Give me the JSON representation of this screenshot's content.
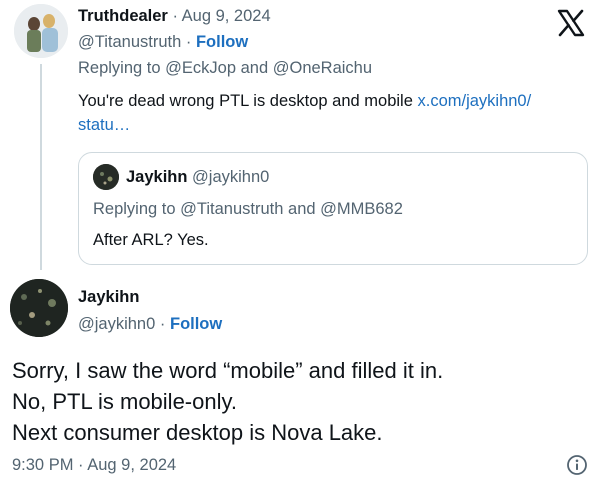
{
  "tweet": {
    "author_name": "Truthdealer",
    "date": "Aug 9, 2024",
    "handle": "@Titanustruth",
    "follow_label": "Follow",
    "replying_prefix": "Replying to",
    "replying_user_1": "@EckJop",
    "replying_and": "and",
    "replying_user_2": "@OneRaichu",
    "text": "You're dead wrong PTL is desktop and mobile",
    "link_line_1": "x.com/jaykihn0/",
    "link_line_2": "statu…"
  },
  "quote": {
    "author_name": "Jaykihn",
    "handle": "@jaykihn0",
    "replying_prefix": "Replying to",
    "replying_user_1": "@Titanustruth",
    "replying_and": "and",
    "replying_user_2": "@MMB682",
    "text": "After ARL? Yes."
  },
  "reply": {
    "author_name": "Jaykihn",
    "handle": "@jaykihn0",
    "follow_label": "Follow",
    "lines": [
      "Sorry, I saw the word “mobile” and filled it in.",
      "No, PTL is mobile-only.",
      "Next consumer desktop is Nova Lake."
    ],
    "time": "9:30 PM",
    "date": "Aug 9, 2024"
  },
  "separator": "·",
  "icons": {
    "brand": "x-logo-icon",
    "info": "info-icon"
  },
  "colors": {
    "text": "#0f1419",
    "muted": "#536471",
    "link": "#1d6fbf",
    "border": "#cfd9de"
  }
}
